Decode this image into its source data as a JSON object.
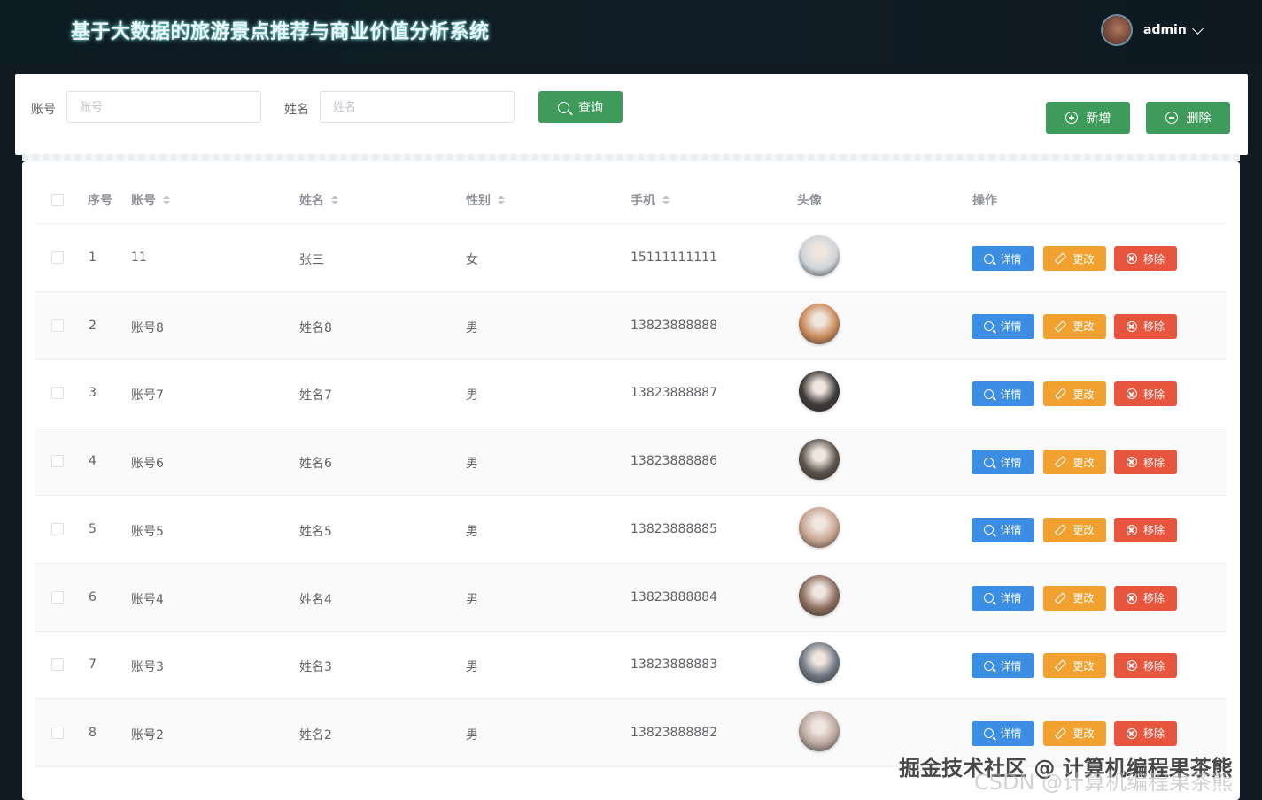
{
  "header": {
    "title": "基于大数据的旅游景点推荐与商业价值分析系统",
    "user_name": "admin"
  },
  "search": {
    "account_label": "账号",
    "account_placeholder": "账号",
    "name_label": "姓名",
    "name_placeholder": "姓名",
    "query_label": "查询",
    "add_label": "新增",
    "delete_label": "删除"
  },
  "table": {
    "headers": {
      "index": "序号",
      "account": "账号",
      "name": "姓名",
      "gender": "性别",
      "phone": "手机",
      "avatar": "头像",
      "actions": "操作"
    },
    "action_labels": {
      "detail": "详情",
      "edit": "更改",
      "remove": "移除"
    },
    "rows": [
      {
        "index": "1",
        "account": "11",
        "name": "张三",
        "gender": "女",
        "phone": "15111111111",
        "avatar_color": "#cfd4d8"
      },
      {
        "index": "2",
        "account": "账号8",
        "name": "姓名8",
        "gender": "男",
        "phone": "13823888888",
        "avatar_color": "#c98a5a"
      },
      {
        "index": "3",
        "account": "账号7",
        "name": "姓名7",
        "gender": "男",
        "phone": "13823888887",
        "avatar_color": "#3d3a38"
      },
      {
        "index": "4",
        "account": "账号6",
        "name": "姓名6",
        "gender": "男",
        "phone": "13823888886",
        "avatar_color": "#5b524c"
      },
      {
        "index": "5",
        "account": "账号5",
        "name": "姓名5",
        "gender": "男",
        "phone": "13823888885",
        "avatar_color": "#c7a38e"
      },
      {
        "index": "6",
        "account": "账号4",
        "name": "姓名4",
        "gender": "男",
        "phone": "13823888884",
        "avatar_color": "#8b6b5c"
      },
      {
        "index": "7",
        "account": "账号3",
        "name": "姓名3",
        "gender": "男",
        "phone": "13823888883",
        "avatar_color": "#6e7680"
      },
      {
        "index": "8",
        "account": "账号2",
        "name": "姓名2",
        "gender": "男",
        "phone": "13823888882",
        "avatar_color": "#b9a59c"
      }
    ]
  },
  "watermark": {
    "juejin": "掘金技术社区 @ 计算机编程果茶熊",
    "csdn": "CSDN @计算机编程果茶熊"
  }
}
